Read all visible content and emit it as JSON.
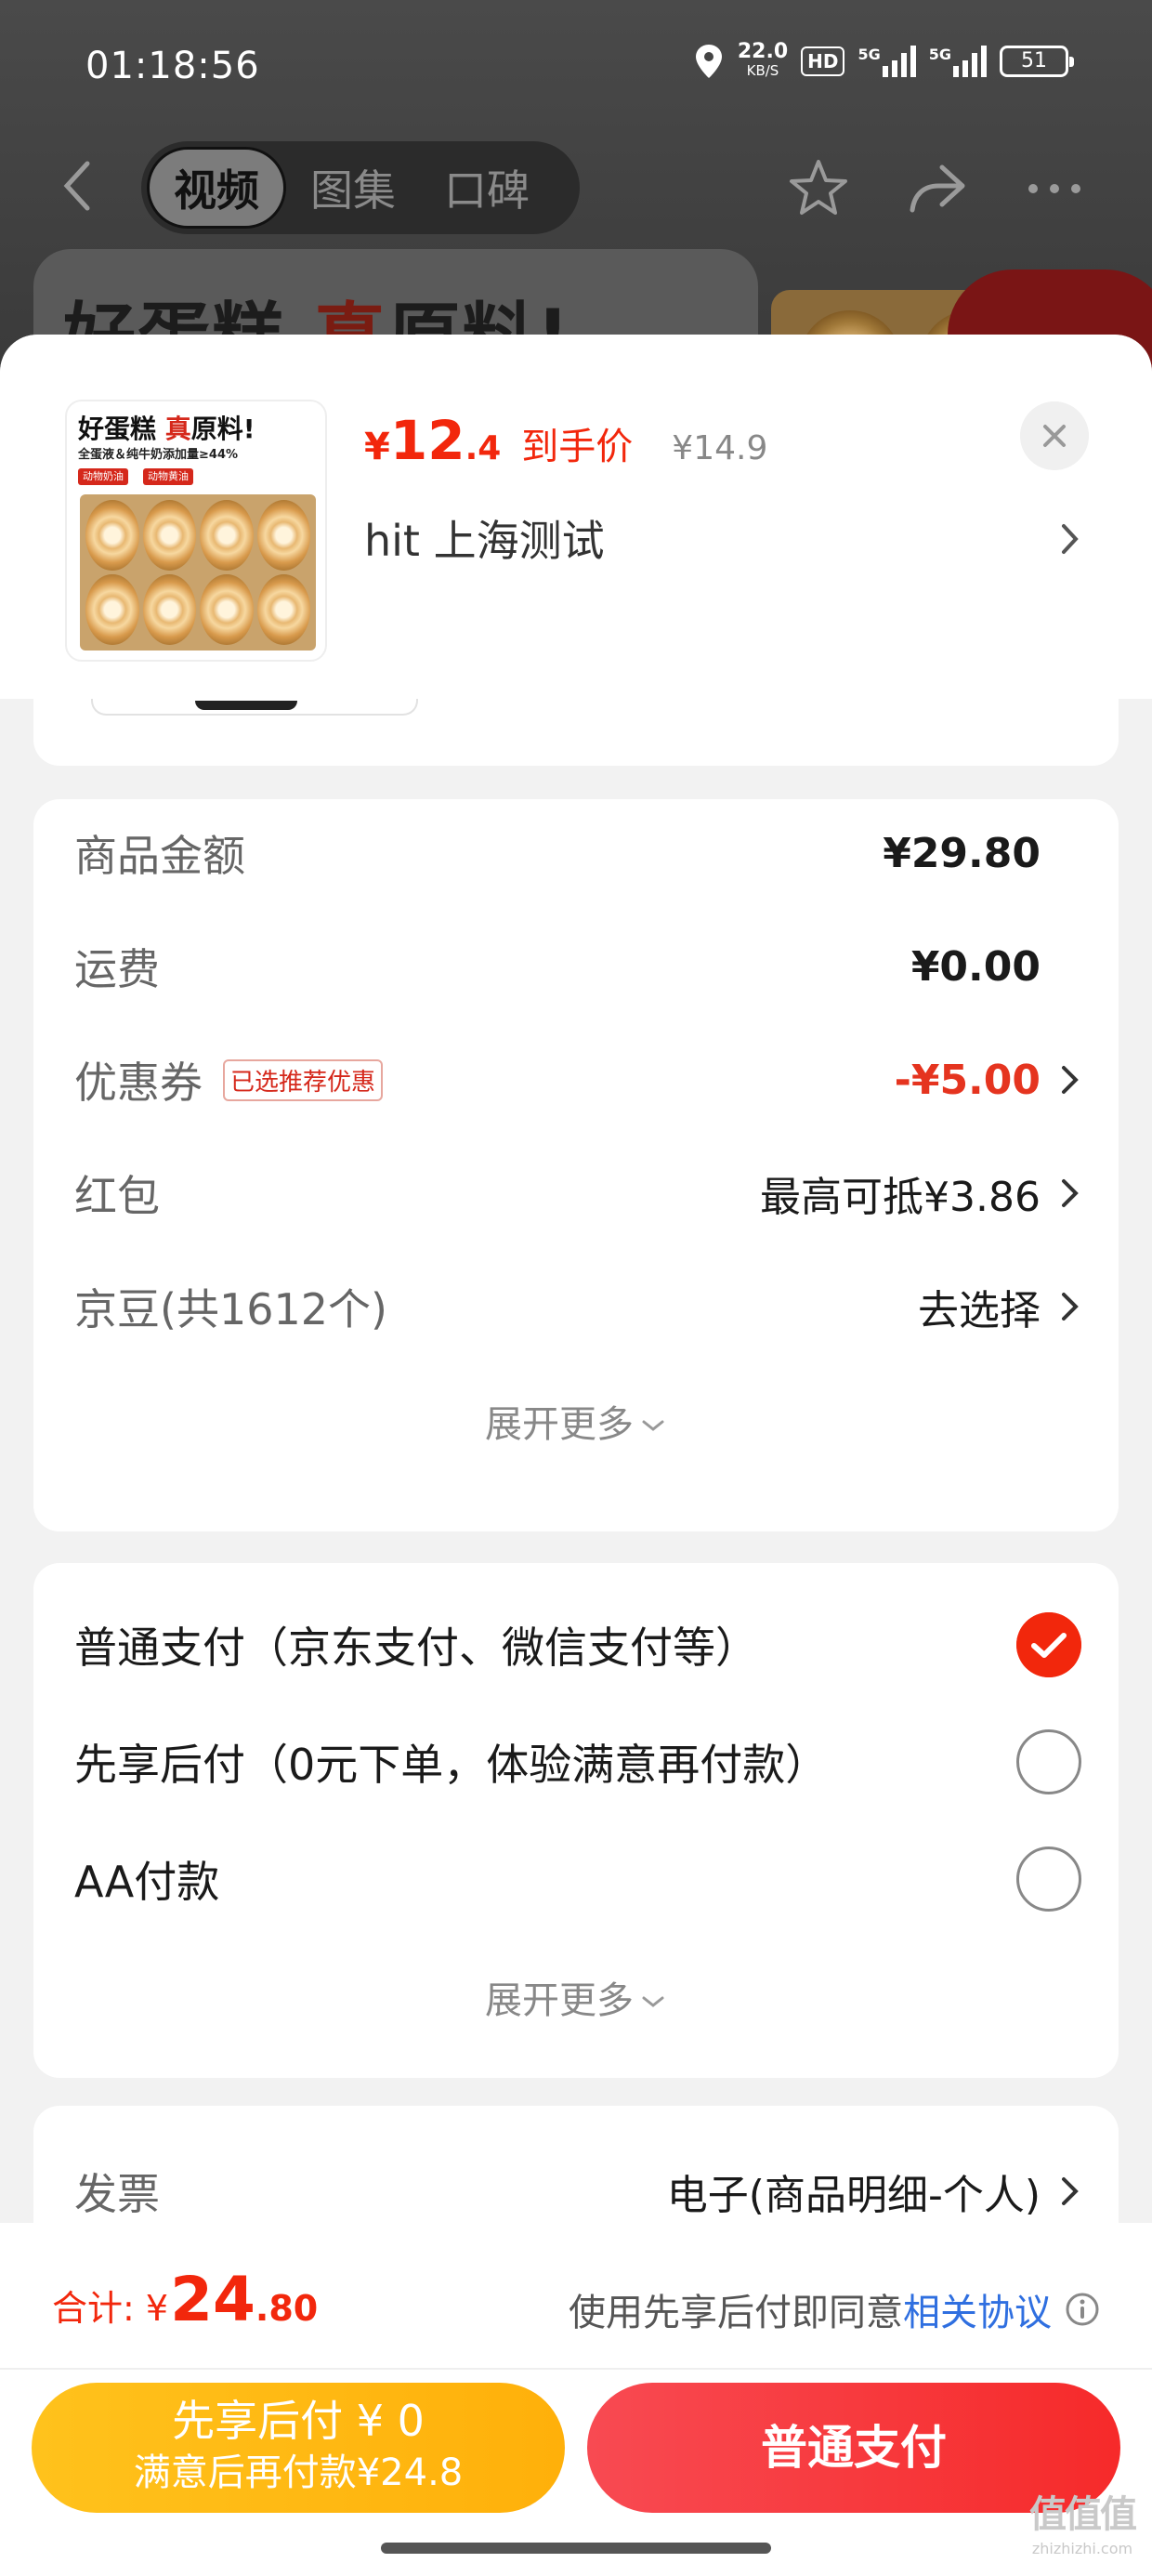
{
  "status_bar": {
    "time": "01:18:56",
    "net_speed": "22.0",
    "net_unit": "KB/S",
    "hd": "HD",
    "sig1_label": "5G",
    "sig2_label": "5G",
    "battery": "51"
  },
  "background_page": {
    "tabs": [
      "视频",
      "图集",
      "口碑"
    ],
    "active_tab": "视频",
    "banner_text_a": "好蛋糕",
    "banner_text_b": "真",
    "banner_text_c": "原料!"
  },
  "product": {
    "thumb_title_a": "好蛋糕",
    "thumb_title_b": "真",
    "thumb_title_c": "原料!",
    "thumb_sub": "全蛋液＆纯牛奶添加量≥44%",
    "thumb_tag1": "动物奶油",
    "thumb_tag2": "动物黄油",
    "price_currency": "¥",
    "price_int": "12",
    "price_dec": ".4",
    "price_tag": "到手价",
    "original_price": "¥14.9",
    "address": "hit  上海测试"
  },
  "summary": {
    "goods_label": "商品金额",
    "goods_value": "¥29.80",
    "shipping_label": "运费",
    "shipping_value": "¥0.00",
    "coupon_label": "优惠券",
    "coupon_badge": "已选推荐优惠",
    "coupon_value": "-¥5.00",
    "redpacket_label": "红包",
    "redpacket_value": "最高可抵¥3.86",
    "jingdou_label": "京豆(共1612个)",
    "jingdou_value": "去选择",
    "expand_label": "展开更多"
  },
  "payment": {
    "options": [
      {
        "label": "普通支付（京东支付、微信支付等）",
        "selected": true
      },
      {
        "label": "先享后付（0元下单，体验满意再付款）",
        "selected": false
      },
      {
        "label": "AA付款",
        "selected": false
      }
    ],
    "expand_label": "展开更多"
  },
  "invoice": {
    "label": "发票",
    "value": "电子(商品明细-个人)"
  },
  "footer": {
    "total_label": "合计: ¥",
    "total_int": "24",
    "total_dec": ".80",
    "agree_text": "使用先享后付即同意",
    "agree_link": "相关协议",
    "btn_later_line1": "先享后付 ¥ 0",
    "btn_later_line2": "满意后再付款¥24.8",
    "btn_pay": "普通支付",
    "watermark_logo": "值值值",
    "watermark_url": "zhizhizhi.com"
  },
  "colors": {
    "accent_red": "#f2270c",
    "pay_yellow": "#ffc21c",
    "link_blue": "#2f6fe0"
  }
}
